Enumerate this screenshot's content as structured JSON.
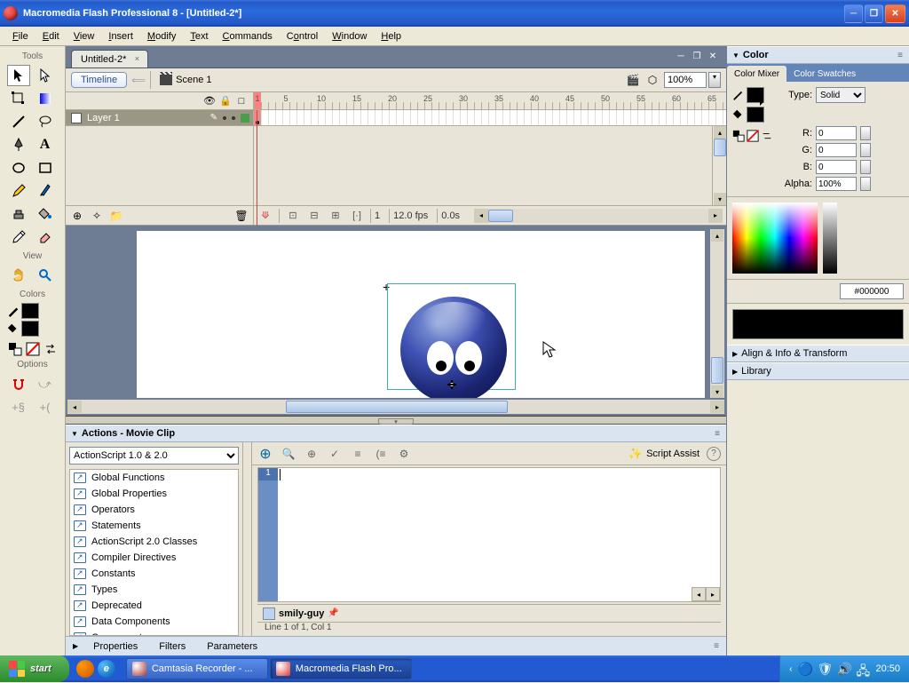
{
  "title": "Macromedia Flash Professional 8 - [Untitled-2*]",
  "menubar": [
    "File",
    "Edit",
    "View",
    "Insert",
    "Modify",
    "Text",
    "Commands",
    "Control",
    "Window",
    "Help"
  ],
  "tools_panel": {
    "title": "Tools",
    "view_title": "View",
    "colors_title": "Colors",
    "options_title": "Options"
  },
  "document": {
    "tab": "Untitled-2*",
    "timeline_btn": "Timeline",
    "scene": "Scene 1",
    "zoom": "100%"
  },
  "timeline": {
    "layer_name": "Layer 1",
    "frame_ticks": [
      1,
      5,
      10,
      15,
      20,
      25,
      30,
      35,
      40,
      45,
      50,
      55,
      60,
      65
    ],
    "status": {
      "frame": "1",
      "fps": "12.0 fps",
      "time": "0.0s"
    }
  },
  "actions": {
    "title": "Actions - Movie Clip",
    "version_select": "ActionScript 1.0 & 2.0",
    "categories": [
      "Global Functions",
      "Global Properties",
      "Operators",
      "Statements",
      "ActionScript 2.0 Classes",
      "Compiler Directives",
      "Constants",
      "Types",
      "Deprecated",
      "Data Components",
      "Components"
    ],
    "script_assist": "Script Assist",
    "symbol_tab": "smily-guy",
    "status_line": "Line 1 of 1, Col 1",
    "line_number": "1"
  },
  "bottom_tabs": [
    "Properties",
    "Filters",
    "Parameters"
  ],
  "right": {
    "color_title": "Color",
    "tabs": {
      "mixer": "Color Mixer",
      "swatches": "Color Swatches"
    },
    "type_label": "Type:",
    "type_value": "Solid",
    "r_label": "R:",
    "r": "0",
    "g_label": "G:",
    "g": "0",
    "b_label": "B:",
    "b": "0",
    "alpha_label": "Alpha:",
    "alpha": "100%",
    "hex": "#000000",
    "align_panel": "Align & Info & Transform",
    "library_panel": "Library"
  },
  "taskbar": {
    "start": "start",
    "items": [
      {
        "label": "Camtasia Recorder - ...",
        "active": false
      },
      {
        "label": "Macromedia Flash Pro...",
        "active": true
      }
    ],
    "clock": "20:50"
  }
}
